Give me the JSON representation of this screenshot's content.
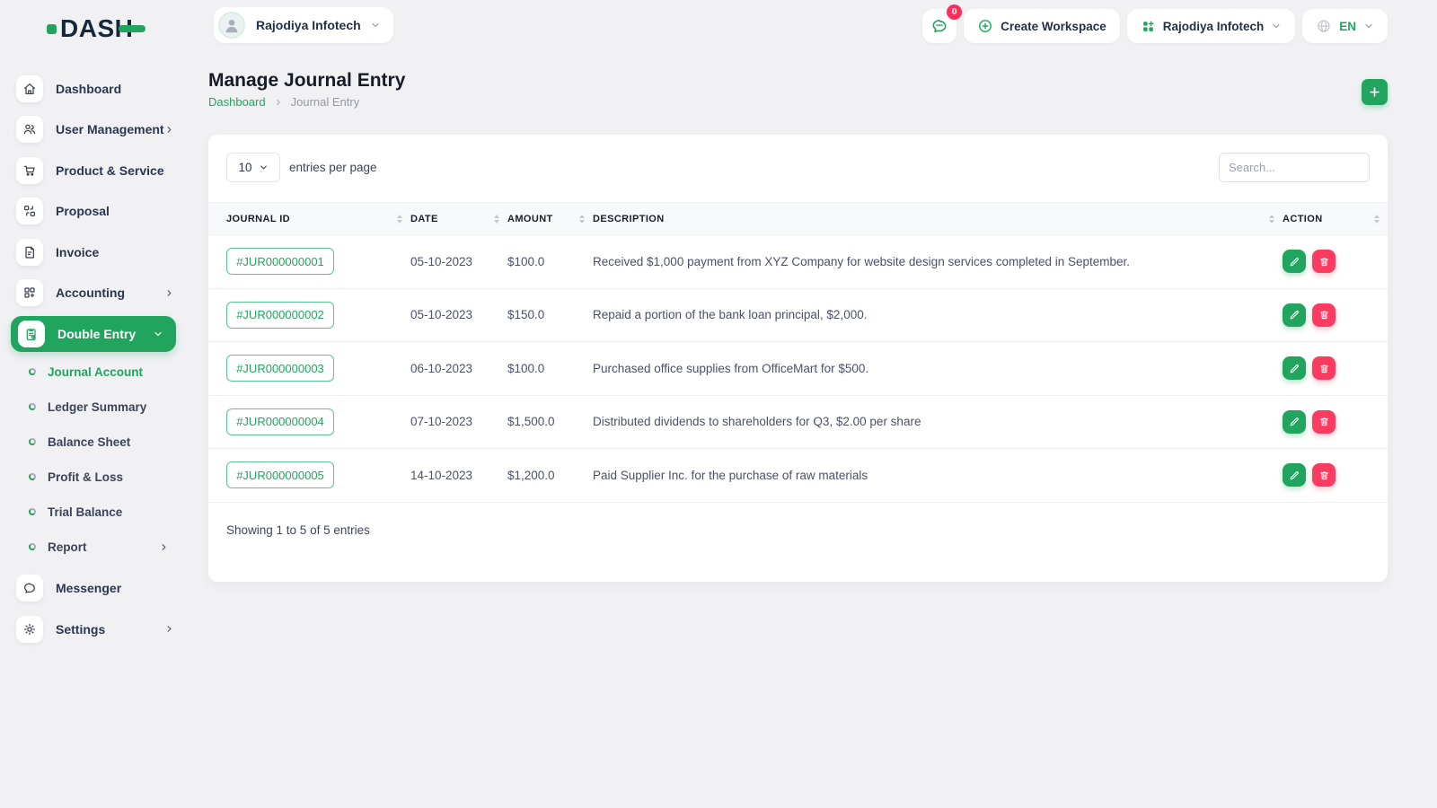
{
  "brand": {
    "name": "DASH"
  },
  "header": {
    "workspace_selector": {
      "label": "Rajodiya Infotech"
    },
    "messages": {
      "badge": "0"
    },
    "create_workspace": {
      "label": "Create Workspace"
    },
    "company_menu": {
      "label": "Rajodiya Infotech"
    },
    "language": {
      "code": "EN"
    }
  },
  "sidebar": {
    "items": [
      {
        "label": "Dashboard"
      },
      {
        "label": "User Management"
      },
      {
        "label": "Product & Service"
      },
      {
        "label": "Proposal"
      },
      {
        "label": "Invoice"
      },
      {
        "label": "Accounting"
      },
      {
        "label": "Double Entry"
      }
    ],
    "sub_items": [
      {
        "label": "Journal Account"
      },
      {
        "label": "Ledger Summary"
      },
      {
        "label": "Balance Sheet"
      },
      {
        "label": "Profit & Loss"
      },
      {
        "label": "Trial Balance"
      },
      {
        "label": "Report"
      }
    ],
    "bottom_items": [
      {
        "label": "Messenger"
      },
      {
        "label": "Settings"
      }
    ]
  },
  "page": {
    "title": "Manage Journal Entry",
    "breadcrumb": {
      "root": "Dashboard",
      "current": "Journal Entry"
    }
  },
  "table": {
    "controls": {
      "page_size": "10",
      "entries_label": "entries per page",
      "search_placeholder": "Search..."
    },
    "columns": [
      "JOURNAL ID",
      "DATE",
      "AMOUNT",
      "DESCRIPTION",
      "ACTION"
    ],
    "rows": [
      {
        "journal_id": "#JUR000000001",
        "date": "05-10-2023",
        "amount": "$100.0",
        "description": "Received $1,000 payment from XYZ Company for website design services completed in September."
      },
      {
        "journal_id": "#JUR000000002",
        "date": "05-10-2023",
        "amount": "$150.0",
        "description": "Repaid a portion of the bank loan principal, $2,000."
      },
      {
        "journal_id": "#JUR000000003",
        "date": "06-10-2023",
        "amount": "$100.0",
        "description": "Purchased office supplies from OfficeMart for $500."
      },
      {
        "journal_id": "#JUR000000004",
        "date": "07-10-2023",
        "amount": "$1,500.0",
        "description": "Distributed dividends to shareholders for Q3, $2.00 per share"
      },
      {
        "journal_id": "#JUR000000005",
        "date": "14-10-2023",
        "amount": "$1,200.0",
        "description": "Paid Supplier Inc. for the purchase of raw materials"
      }
    ],
    "summary": "Showing 1 to 5 of 5 entries"
  },
  "colors": {
    "primary_green": "#21a55e",
    "danger_red": "#fb3b60",
    "navy": "#16283c",
    "background": "#f1f1f4"
  }
}
